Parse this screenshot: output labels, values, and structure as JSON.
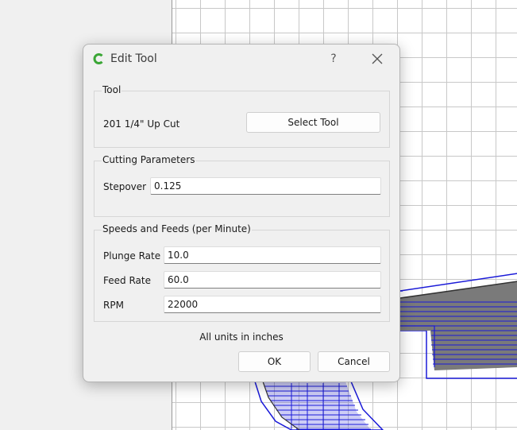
{
  "dialog": {
    "title": "Edit Tool",
    "help_label": "?",
    "tool_group": {
      "title": "Tool",
      "tool_name": "201 1/4\" Up Cut",
      "select_button": "Select Tool"
    },
    "cutting_group": {
      "title": "Cutting Parameters",
      "stepover_label": "Stepover",
      "stepover_value": "0.125"
    },
    "speeds_group": {
      "title": "Speeds and Feeds (per Minute)",
      "plunge_label": "Plunge Rate",
      "plunge_value": "10.0",
      "feed_label": "Feed Rate",
      "feed_value": "60.0",
      "rpm_label": "RPM",
      "rpm_value": "22000"
    },
    "units_note": "All units in inches",
    "ok_button": "OK",
    "cancel_button": "Cancel"
  },
  "colors": {
    "toolpath_blue": "#1a1ad8",
    "material_gray": "#7a7a7a",
    "app_icon_green": "#3aa635"
  }
}
